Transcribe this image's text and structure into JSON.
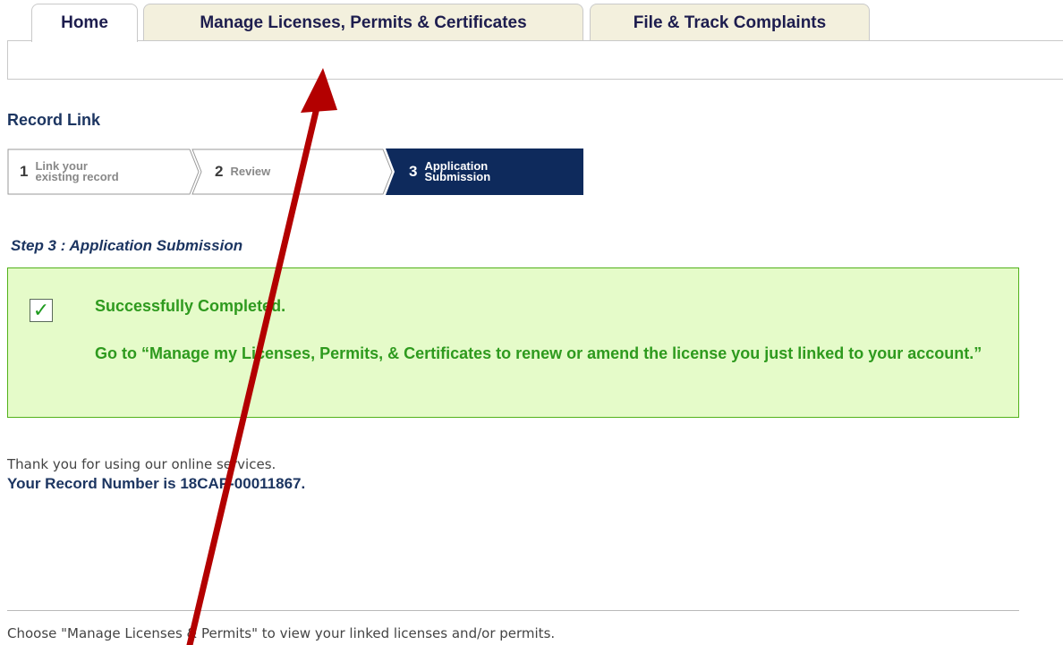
{
  "tabs": {
    "home": "Home",
    "manage": "Manage Licenses, Permits & Certificates",
    "complaints": "File & Track Complaints"
  },
  "page_title": "Record Link",
  "steps": [
    {
      "num": "1",
      "label": "Link your existing record",
      "state": "completed"
    },
    {
      "num": "2",
      "label": "Review",
      "state": "completed"
    },
    {
      "num": "3",
      "label": "Application Submission",
      "state": "active"
    }
  ],
  "step_header": "Step 3 : Application Submission",
  "success": {
    "title": "Successfully Completed.",
    "message": "Go to “Manage my Licenses, Permits, & Certificates to renew or amend the license you just linked to your account.”",
    "icon": "checkbox-checked-icon"
  },
  "thanks_text": "Thank you for using our online services.",
  "record_number_text": "Your Record Number is 18CAP-00011867.",
  "footer_text": "Choose \"Manage Licenses & Permits\" to view your linked licenses and/or permits.",
  "colors": {
    "nav_text": "#1d1d4e",
    "tab_bg": "#f3f0dd",
    "active_step": "#0e2a5c",
    "success_bg": "#e5fbc9",
    "success_border": "#52b21a",
    "success_text": "#2e9a1e",
    "annotation_arrow": "#b30000"
  }
}
